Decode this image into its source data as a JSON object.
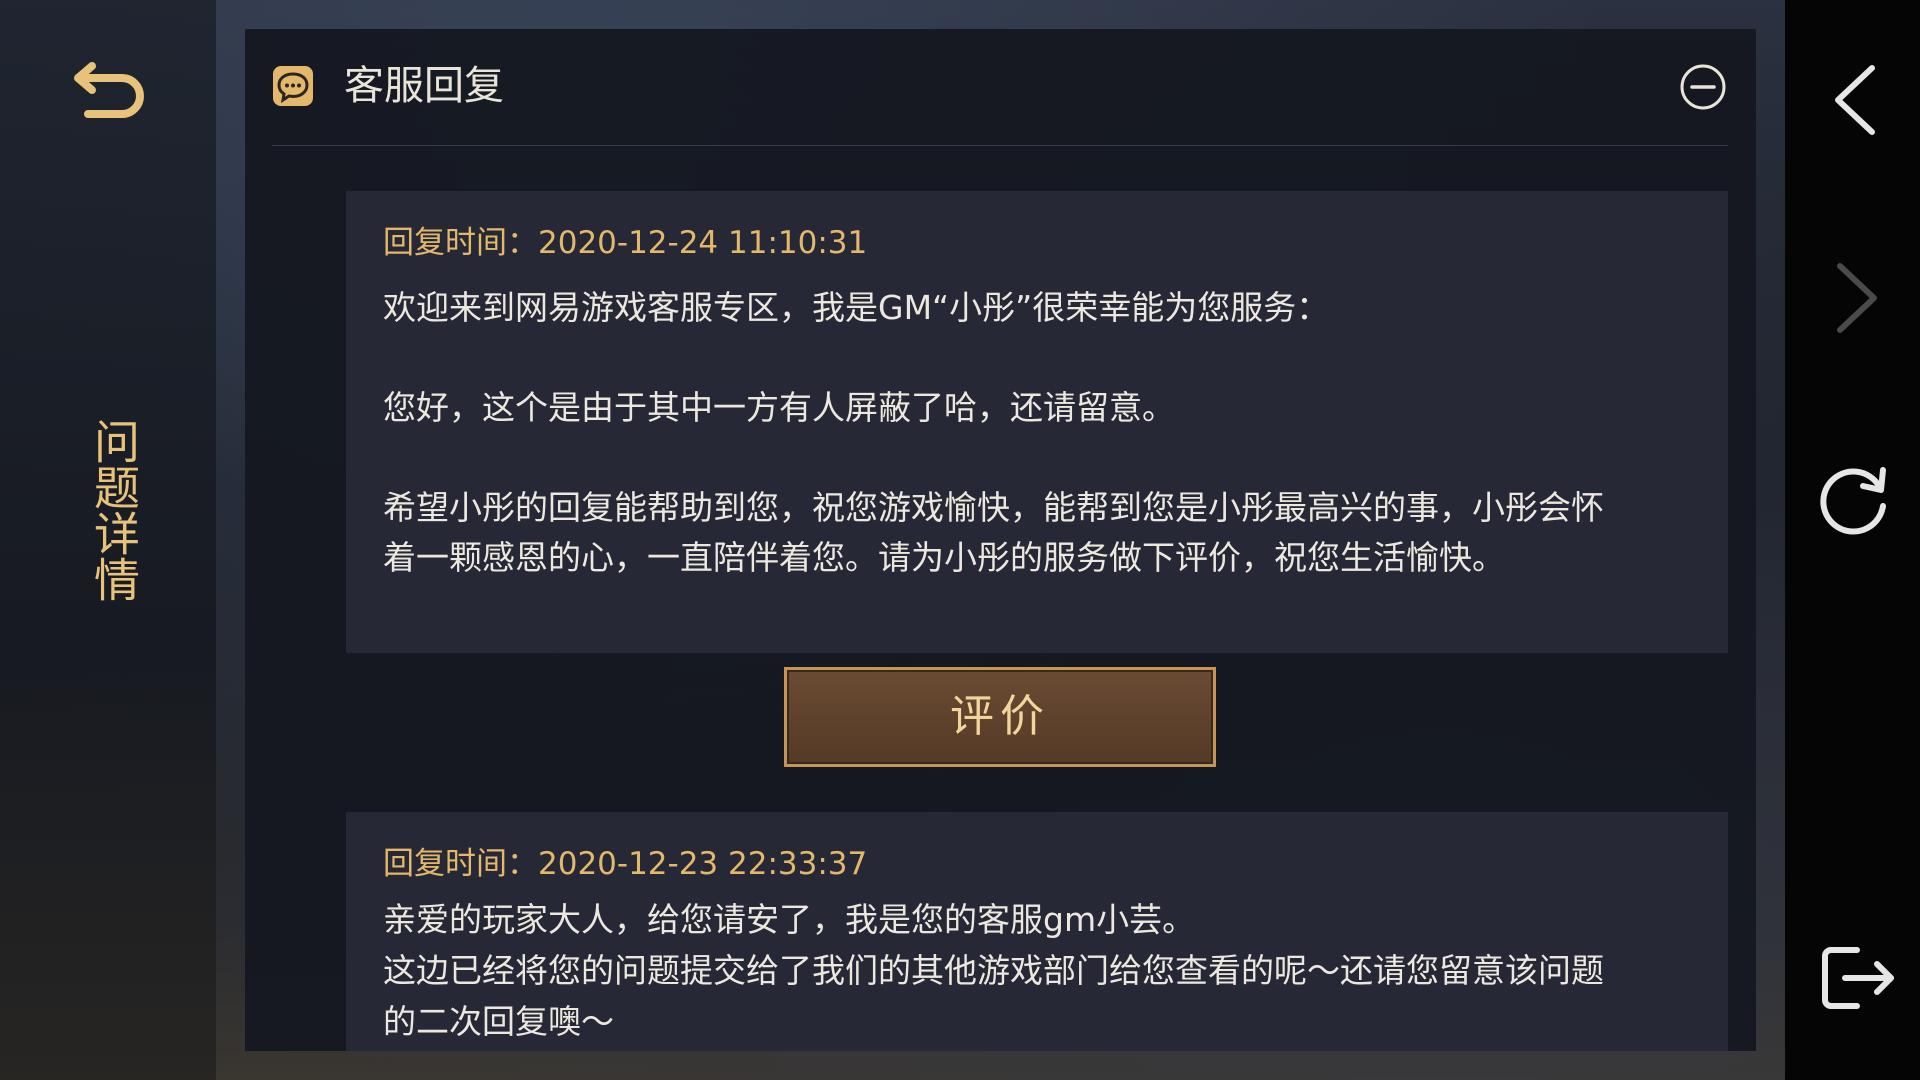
{
  "sidebar": {
    "title": "问题详情"
  },
  "panel": {
    "title": "客服回复"
  },
  "replies": [
    {
      "time_label": "回复时间：2020-12-24 11:10:31",
      "lines": [
        "欢迎来到网易游戏客服专区，我是GM“小彤”很荣幸能为您服务：",
        "",
        "您好，这个是由于其中一方有人屏蔽了哈，还请留意。",
        "",
        "希望小彤的回复能帮助到您，祝您游戏愉快，能帮到您是小彤最高兴的事，小彤会怀",
        "着一颗感恩的心，一直陪伴着您。请为小彤的服务做下评价，祝您生活愉快。"
      ]
    },
    {
      "time_label": "回复时间：2020-12-23 22:33:37",
      "lines": [
        "亲爱的玩家大人，给您请安了，我是您的客服gm小芸。",
        "这边已经将您的问题提交给了我们的其他游戏部门给您查看的呢～还请您留意该问题",
        "的二次回复噢～"
      ]
    }
  ],
  "rate_button": {
    "label": "评价"
  },
  "icons": {
    "back": "undo-arrow-icon",
    "chat": "chat-bubble-icon",
    "collapse": "minus-circle-icon",
    "nav_back": "chevron-left-icon",
    "nav_forward": "chevron-right-icon",
    "refresh": "refresh-icon",
    "exit": "exit-icon"
  },
  "colors": {
    "accent_gold": "#e3b86b",
    "text_light": "#ece8df",
    "button_brown": "#5e422d"
  }
}
